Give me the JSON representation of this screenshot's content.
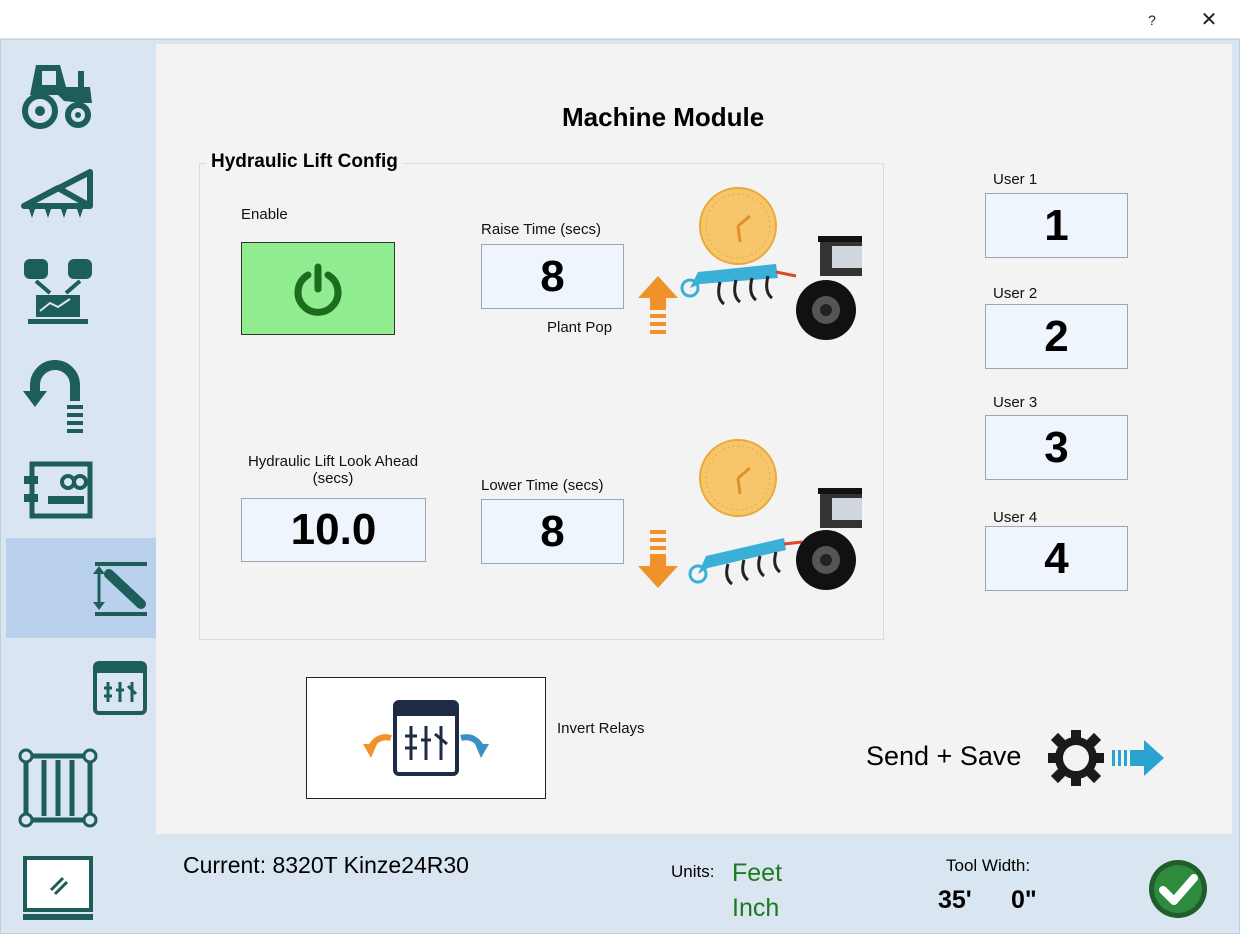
{
  "window": {
    "help_label": "?",
    "close_label": "✕"
  },
  "sidebar": {
    "items": [
      {
        "name": "tractor-icon"
      },
      {
        "name": "implement-icon"
      },
      {
        "name": "controllers-icon"
      },
      {
        "name": "u-turn-icon"
      },
      {
        "name": "module-board-icon"
      },
      {
        "name": "hydraulic-lift-icon",
        "active": true
      },
      {
        "name": "relay-icon"
      },
      {
        "name": "frame-icon"
      },
      {
        "name": "display-icon"
      }
    ]
  },
  "main": {
    "title": "Machine Module",
    "hydraulic": {
      "group_title": "Hydraulic Lift Config",
      "enable_label": "Enable",
      "enabled": true,
      "raise_label": "Raise Time (secs)",
      "raise_value": "8",
      "plant_pop_label": "Plant Pop",
      "lookahead_label": "Hydraulic Lift Look Ahead (secs)",
      "lookahead_value": "10.0",
      "lower_label": "Lower Time (secs)",
      "lower_value": "8"
    },
    "users": [
      {
        "label": "User 1",
        "value": "1"
      },
      {
        "label": "User 2",
        "value": "2"
      },
      {
        "label": "User 3",
        "value": "3"
      },
      {
        "label": "User 4",
        "value": "4"
      }
    ],
    "invert_relays_label": "Invert Relays",
    "send_save_label": "Send + Save"
  },
  "status": {
    "current": "Current: 8320T Kinze24R30",
    "units_label": "Units:",
    "units_primary": "Feet",
    "units_secondary": "Inch",
    "tool_width_label": "Tool Width:",
    "tool_width_feet": "35'",
    "tool_width_inches": "0\""
  },
  "colors": {
    "accent_teal": "#1d5e5a",
    "enable_green": "#90ee90",
    "arrow_orange": "#f0922a",
    "implement_blue": "#3ab0d8",
    "units_green": "#1e7a1e"
  }
}
